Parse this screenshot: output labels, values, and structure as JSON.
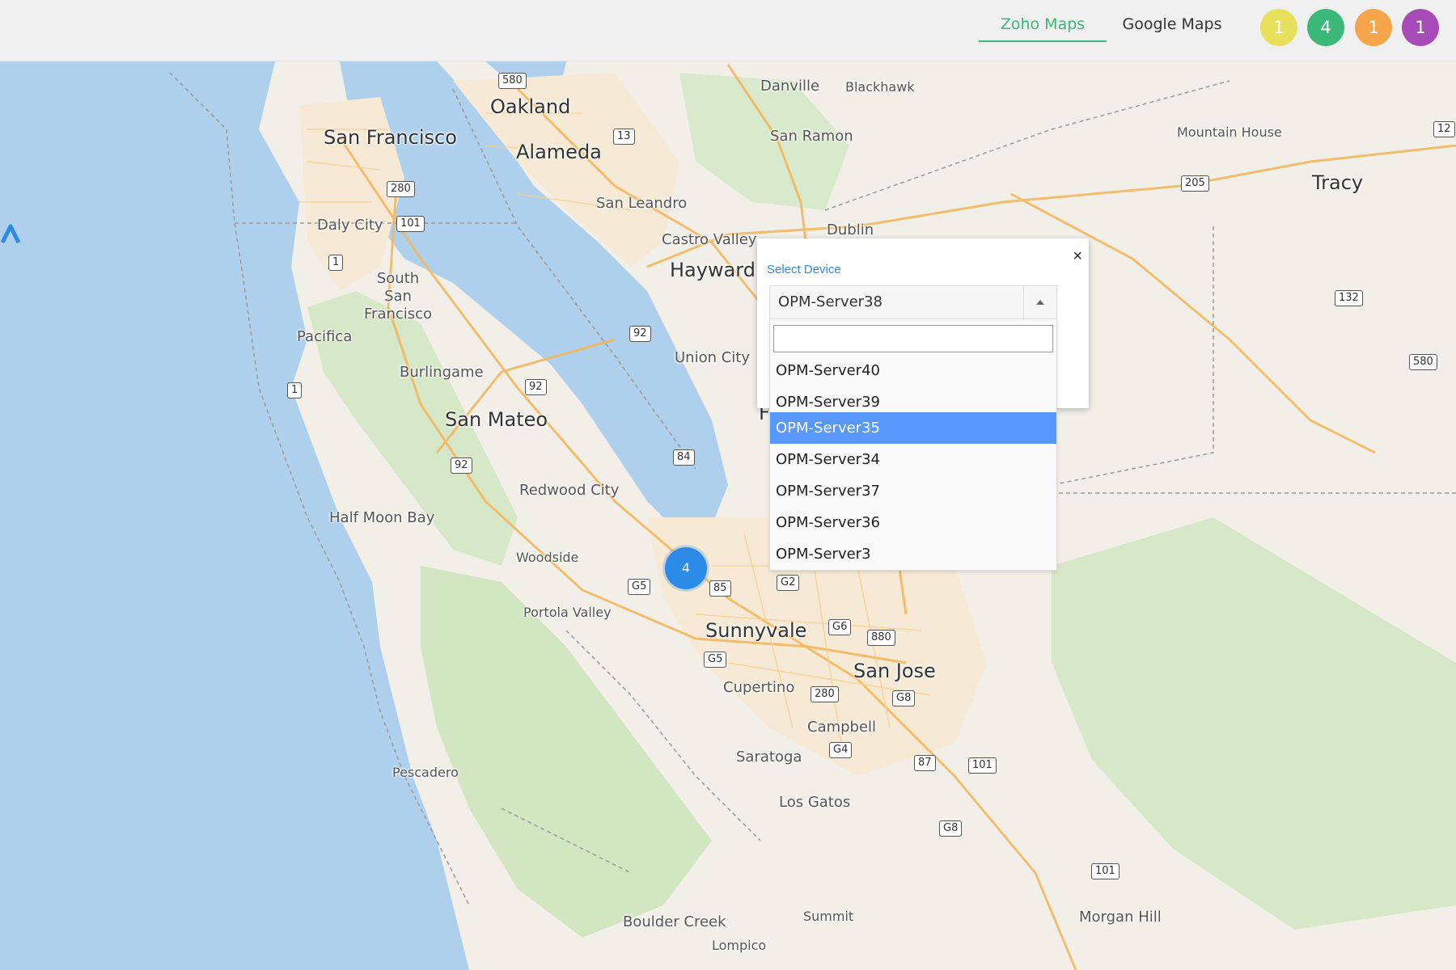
{
  "tabs": [
    {
      "label": "Zoho Maps",
      "active": true
    },
    {
      "label": "Google Maps",
      "active": false
    }
  ],
  "badges": [
    {
      "count": "1",
      "color": "#e8df5c"
    },
    {
      "count": "4",
      "color": "#3cb878"
    },
    {
      "count": "1",
      "color": "#f7a54a"
    },
    {
      "count": "1",
      "color": "#a64cb7"
    }
  ],
  "map": {
    "places": {
      "san_francisco": "San Francisco",
      "oakland": "Oakland",
      "alameda": "Alameda",
      "danville": "Danville",
      "blackhawk": "Blackhawk",
      "san_ramon": "San Ramon",
      "mountain_house": "Mountain House",
      "tracy": "Tracy",
      "san_leandro": "San Leandro",
      "daly_city": "Daly City",
      "dublin": "Dublin",
      "castro_valley": "Castro Valley",
      "hayward": "Hayward",
      "south_san_francisco": "South San Francisco",
      "pacifica": "Pacifica",
      "union_city": "Union City",
      "burlingame": "Burlingame",
      "san_mateo": "San Mateo",
      "redwood_city": "Redwood City",
      "half_moon_bay": "Half Moon Bay",
      "woodside": "Woodside",
      "portola_valley": "Portola Valley",
      "sunnyvale": "Sunnyvale",
      "san_jose": "San Jose",
      "cupertino": "Cupertino",
      "campbell": "Campbell",
      "saratoga": "Saratoga",
      "pescadero": "Pescadero",
      "los_gatos": "Los Gatos",
      "boulder_creek": "Boulder Creek",
      "summit": "Summit",
      "lompico": "Lompico",
      "morgan_hill": "Morgan Hill",
      "fremont_partial": "F"
    },
    "shields": [
      "580",
      "13",
      "280",
      "101",
      "1",
      "92",
      "92",
      "92",
      "1",
      "84",
      "G5",
      "85",
      "G2",
      "G6",
      "880",
      "G5",
      "280",
      "G8",
      "G4",
      "87",
      "101",
      "G8",
      "101",
      "205",
      "132",
      "580",
      "12"
    ],
    "cluster_count": "4",
    "pin_icon": "map-marker-icon"
  },
  "popup": {
    "close_label": "×",
    "title": "Select Device",
    "selected_value": "OPM-Server38",
    "search_value": "",
    "options": [
      "OPM-Server40",
      "OPM-Server39",
      "OPM-Server35",
      "OPM-Server34",
      "OPM-Server37",
      "OPM-Server36",
      "OPM-Server3"
    ],
    "highlighted_option": "OPM-Server35"
  }
}
